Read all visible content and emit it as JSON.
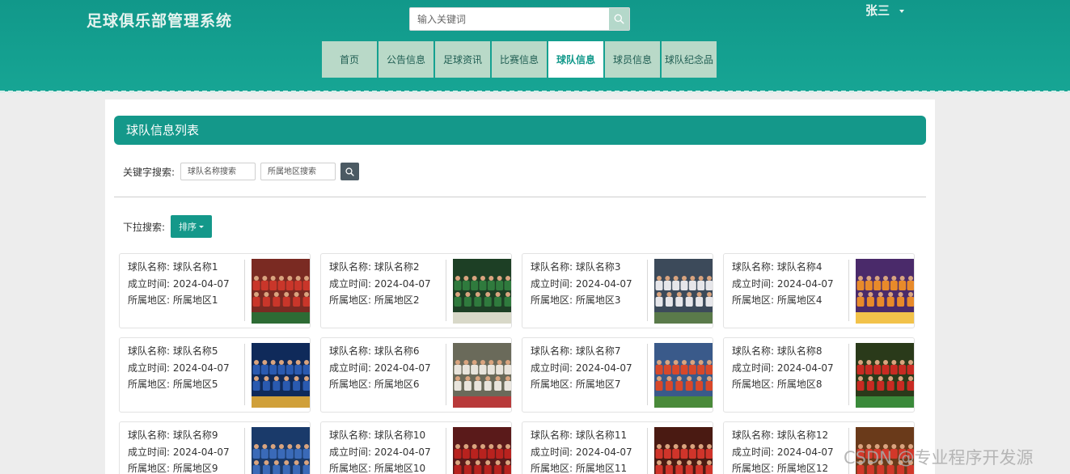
{
  "header": {
    "site_title": "足球俱乐部管理系统",
    "search_placeholder": "输入关键词",
    "user_name": "张三"
  },
  "nav": [
    {
      "label": "首页",
      "active": false
    },
    {
      "label": "公告信息",
      "active": false
    },
    {
      "label": "足球资讯",
      "active": false
    },
    {
      "label": "比赛信息",
      "active": false
    },
    {
      "label": "球队信息",
      "active": true
    },
    {
      "label": "球员信息",
      "active": false
    },
    {
      "label": "球队纪念品",
      "active": false
    }
  ],
  "main": {
    "list_title": "球队信息列表",
    "keyword_label": "关键字搜索:",
    "name_placeholder": "球队名称搜索",
    "region_placeholder": "所属地区搜索",
    "dropdown_label": "下拉搜索:",
    "sort_label": "排序"
  },
  "field_labels": {
    "name": "球队名称:",
    "founded": "成立时间:",
    "region": "所属地区:"
  },
  "teams": [
    {
      "name": "球队名称1",
      "founded": "2024-04-07",
      "region": "所属地区1"
    },
    {
      "name": "球队名称2",
      "founded": "2024-04-07",
      "region": "所属地区2"
    },
    {
      "name": "球队名称3",
      "founded": "2024-04-07",
      "region": "所属地区3"
    },
    {
      "name": "球队名称4",
      "founded": "2024-04-07",
      "region": "所属地区4"
    },
    {
      "name": "球队名称5",
      "founded": "2024-04-07",
      "region": "所属地区5"
    },
    {
      "name": "球队名称6",
      "founded": "2024-04-07",
      "region": "所属地区6"
    },
    {
      "name": "球队名称7",
      "founded": "2024-04-07",
      "region": "所属地区7"
    },
    {
      "name": "球队名称8",
      "founded": "2024-04-07",
      "region": "所属地区8"
    },
    {
      "name": "球队名称9",
      "founded": "2024-04-07",
      "region": "所属地区9"
    },
    {
      "name": "球队名称10",
      "founded": "2024-04-07",
      "region": "所属地区10"
    },
    {
      "name": "球队名称11",
      "founded": "2024-04-07",
      "region": "所属地区11"
    },
    {
      "name": "球队名称12",
      "founded": "2024-04-07",
      "region": "所属地区12"
    }
  ],
  "team_photo_palettes": [
    [
      "#7a2a22",
      "#c9362a",
      "#2d6b34"
    ],
    [
      "#1d3f25",
      "#2f7a3d",
      "#d8d8c8"
    ],
    [
      "#3c4a5a",
      "#e6e6ea",
      "#5a7a4a"
    ],
    [
      "#4a2a6a",
      "#e88a2a",
      "#f2c24a"
    ],
    [
      "#0f2a5a",
      "#2a5ab0",
      "#d0a03a"
    ],
    [
      "#6a6a5a",
      "#e8e4dc",
      "#b83a3a"
    ],
    [
      "#3a5a8a",
      "#d8482a",
      "#4a8a3a"
    ],
    [
      "#2a3a1a",
      "#c82a22",
      "#3a8a3a"
    ],
    [
      "#1a3a6a",
      "#3a6ab8",
      "#9ab8d8"
    ],
    [
      "#5a1a1a",
      "#b8221e",
      "#2a6a2a"
    ],
    [
      "#4a1a12",
      "#d0342a",
      "#3a2a2a"
    ],
    [
      "#6a3a1a",
      "#d2382a",
      "#4a7a3a"
    ]
  ],
  "watermark": "CSDN @专业程序开发源"
}
